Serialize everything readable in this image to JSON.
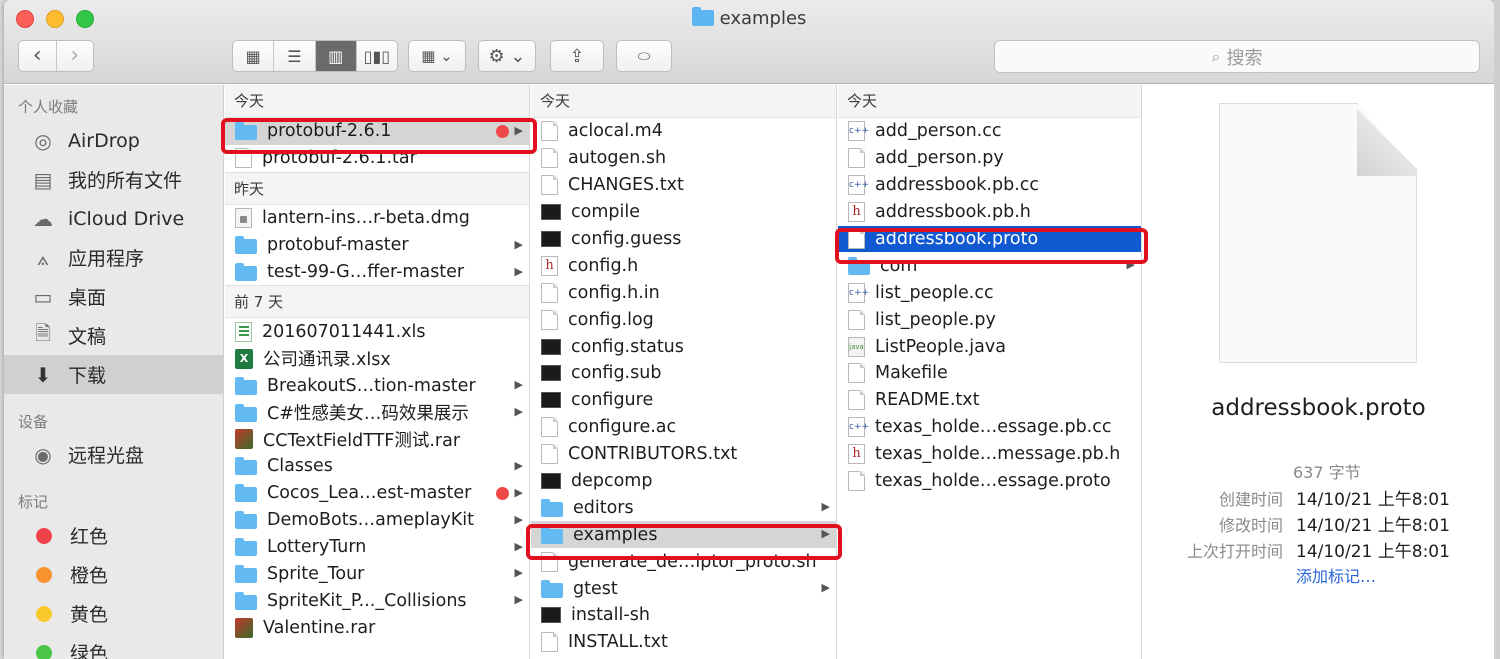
{
  "window": {
    "title": "examples"
  },
  "toolbar": {
    "back_icon": "chevron-left-icon",
    "forward_icon": "chevron-right-icon",
    "search_placeholder": "搜索"
  },
  "sidebar": {
    "favorites_header": "个人收藏",
    "favorites": [
      {
        "label": "AirDrop",
        "icon": "airdrop-icon"
      },
      {
        "label": "我的所有文件",
        "icon": "all-files-icon"
      },
      {
        "label": "iCloud Drive",
        "icon": "cloud-icon"
      },
      {
        "label": "应用程序",
        "icon": "applications-icon"
      },
      {
        "label": "桌面",
        "icon": "desktop-icon"
      },
      {
        "label": "文稿",
        "icon": "documents-icon"
      },
      {
        "label": "下载",
        "icon": "downloads-icon"
      }
    ],
    "devices_header": "设备",
    "devices": [
      {
        "label": "远程光盘",
        "icon": "disc-icon"
      }
    ],
    "tags_header": "标记",
    "tags": [
      {
        "label": "红色",
        "color": "#f0424a"
      },
      {
        "label": "橙色",
        "color": "#f7922e"
      },
      {
        "label": "黄色",
        "color": "#f8c92a"
      },
      {
        "label": "绿色",
        "color": "#4ac548"
      }
    ]
  },
  "column1": {
    "group_today": "今天",
    "today": [
      {
        "name": "protobuf-2.6.1",
        "icon": "folder",
        "selected": true,
        "tag": "red",
        "chevron": true
      },
      {
        "name": "protobuf-2.6.1.tar",
        "icon": "doc"
      }
    ],
    "group_yesterday": "昨天",
    "yesterday": [
      {
        "name": "lantern-ins…r-beta.dmg",
        "icon": "dmg"
      },
      {
        "name": "protobuf-master",
        "icon": "folder",
        "chevron": true
      },
      {
        "name": "test-99-G…ffer-master",
        "icon": "folder",
        "chevron": true
      }
    ],
    "group_week": "前 7 天",
    "week": [
      {
        "name": "201607011441.xls",
        "icon": "xls"
      },
      {
        "name": "公司通讯录.xlsx",
        "icon": "xlsx"
      },
      {
        "name": "BreakoutS…tion-master",
        "icon": "folder",
        "chevron": true
      },
      {
        "name": "C#性感美女…码效果展示",
        "icon": "folder",
        "chevron": true
      },
      {
        "name": "CCTextFieldTTF测试.rar",
        "icon": "rar"
      },
      {
        "name": "Classes",
        "icon": "folder",
        "chevron": true
      },
      {
        "name": "Cocos_Lea…est-master",
        "icon": "folder",
        "tag": "red",
        "chevron": true
      },
      {
        "name": "DemoBots…ameplayKit",
        "icon": "folder",
        "chevron": true
      },
      {
        "name": "LotteryTurn",
        "icon": "folder",
        "chevron": true
      },
      {
        "name": "Sprite_Tour",
        "icon": "folder",
        "chevron": true
      },
      {
        "name": "SpriteKit_P..._Collisions",
        "icon": "folder",
        "chevron": true
      },
      {
        "name": "Valentine.rar",
        "icon": "rar"
      }
    ]
  },
  "column2": {
    "group_today": "今天",
    "items": [
      {
        "name": "aclocal.m4",
        "icon": "doc"
      },
      {
        "name": "autogen.sh",
        "icon": "doc"
      },
      {
        "name": "CHANGES.txt",
        "icon": "doc"
      },
      {
        "name": "compile",
        "icon": "term"
      },
      {
        "name": "config.guess",
        "icon": "term"
      },
      {
        "name": "config.h",
        "icon": "h"
      },
      {
        "name": "config.h.in",
        "icon": "doc"
      },
      {
        "name": "config.log",
        "icon": "doc"
      },
      {
        "name": "config.status",
        "icon": "term"
      },
      {
        "name": "config.sub",
        "icon": "term"
      },
      {
        "name": "configure",
        "icon": "term"
      },
      {
        "name": "configure.ac",
        "icon": "doc"
      },
      {
        "name": "CONTRIBUTORS.txt",
        "icon": "doc"
      },
      {
        "name": "depcomp",
        "icon": "term"
      },
      {
        "name": "editors",
        "icon": "folder",
        "chevron": true
      },
      {
        "name": "examples",
        "icon": "folder",
        "chevron": true,
        "selected": true
      },
      {
        "name": "generate_de…iptor_proto.sh",
        "icon": "doc"
      },
      {
        "name": "gtest",
        "icon": "folder",
        "chevron": true
      },
      {
        "name": "install-sh",
        "icon": "term"
      },
      {
        "name": "INSTALL.txt",
        "icon": "doc"
      }
    ]
  },
  "column3": {
    "group_today": "今天",
    "items": [
      {
        "name": "add_person.cc",
        "icon": "c"
      },
      {
        "name": "add_person.py",
        "icon": "doc"
      },
      {
        "name": "addressbook.pb.cc",
        "icon": "c"
      },
      {
        "name": "addressbook.pb.h",
        "icon": "h"
      },
      {
        "name": "addressbook.proto",
        "icon": "doc",
        "selected": true
      },
      {
        "name": "com",
        "icon": "folder",
        "chevron": true
      },
      {
        "name": "list_people.cc",
        "icon": "c"
      },
      {
        "name": "list_people.py",
        "icon": "doc"
      },
      {
        "name": "ListPeople.java",
        "icon": "java"
      },
      {
        "name": "Makefile",
        "icon": "doc"
      },
      {
        "name": "README.txt",
        "icon": "doc"
      },
      {
        "name": "texas_holde…essage.pb.cc",
        "icon": "c"
      },
      {
        "name": "texas_holde…message.pb.h",
        "icon": "h"
      },
      {
        "name": "texas_holde…essage.proto",
        "icon": "doc"
      }
    ]
  },
  "preview": {
    "filename": "addressbook.proto",
    "size": "637 字节",
    "created_label": "创建时间",
    "created_value": "14/10/21 上午8:01",
    "modified_label": "修改时间",
    "modified_value": "14/10/21 上午8:01",
    "opened_label": "上次打开时间",
    "opened_value": "14/10/21 上午8:01",
    "add_tags_link": "添加标记…"
  },
  "colors": {
    "selection_blue": "#1159d1",
    "highlight_red": "#e0101e",
    "folder_blue": "#63baf2"
  }
}
